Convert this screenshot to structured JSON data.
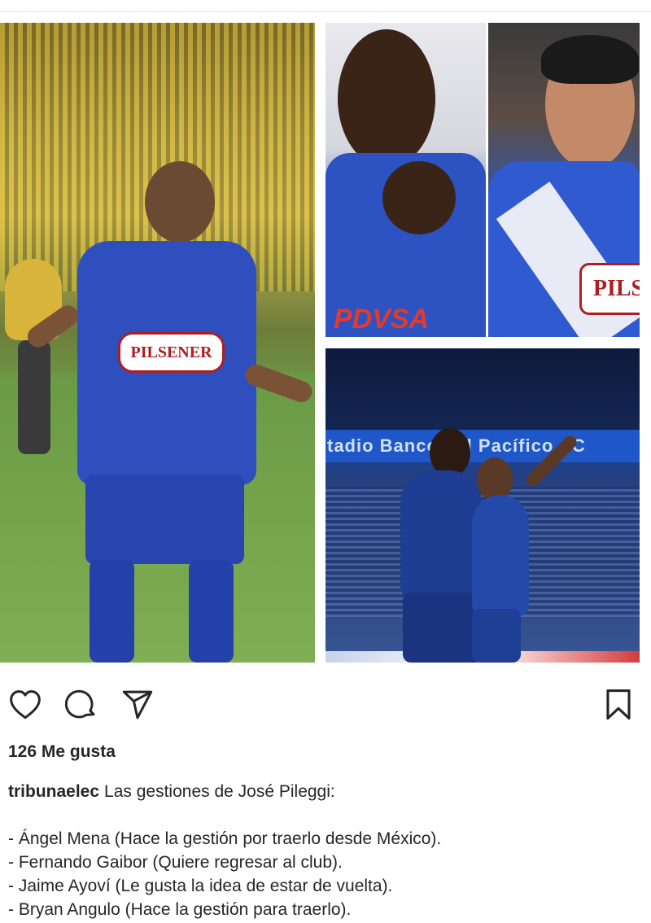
{
  "post": {
    "images": {
      "stadium_banner_text": "tadio Banco del Pacífico - C",
      "main_sponsor": "PILSENER",
      "top_right_sponsor": "PILS",
      "top_mid_sponsor": "PDVSA"
    },
    "actions": {
      "like_icon": "heart-icon",
      "comment_icon": "comment-icon",
      "share_icon": "paper-plane-icon",
      "save_icon": "bookmark-icon"
    },
    "likes_text": "126 Me gusta",
    "caption": {
      "username": "tribunaelec",
      "first_line": "Las gestiones de José Pileggi:",
      "items": [
        "- Ángel Mena (Hace la gestión por traerlo desde México).",
        "- Fernando Gaibor (Quiere regresar al club).",
        "- Jaime Ayoví (Le gusta la idea de estar de vuelta).",
        "- Bryan Angulo (Hace la gestión para traerlo)."
      ]
    }
  }
}
